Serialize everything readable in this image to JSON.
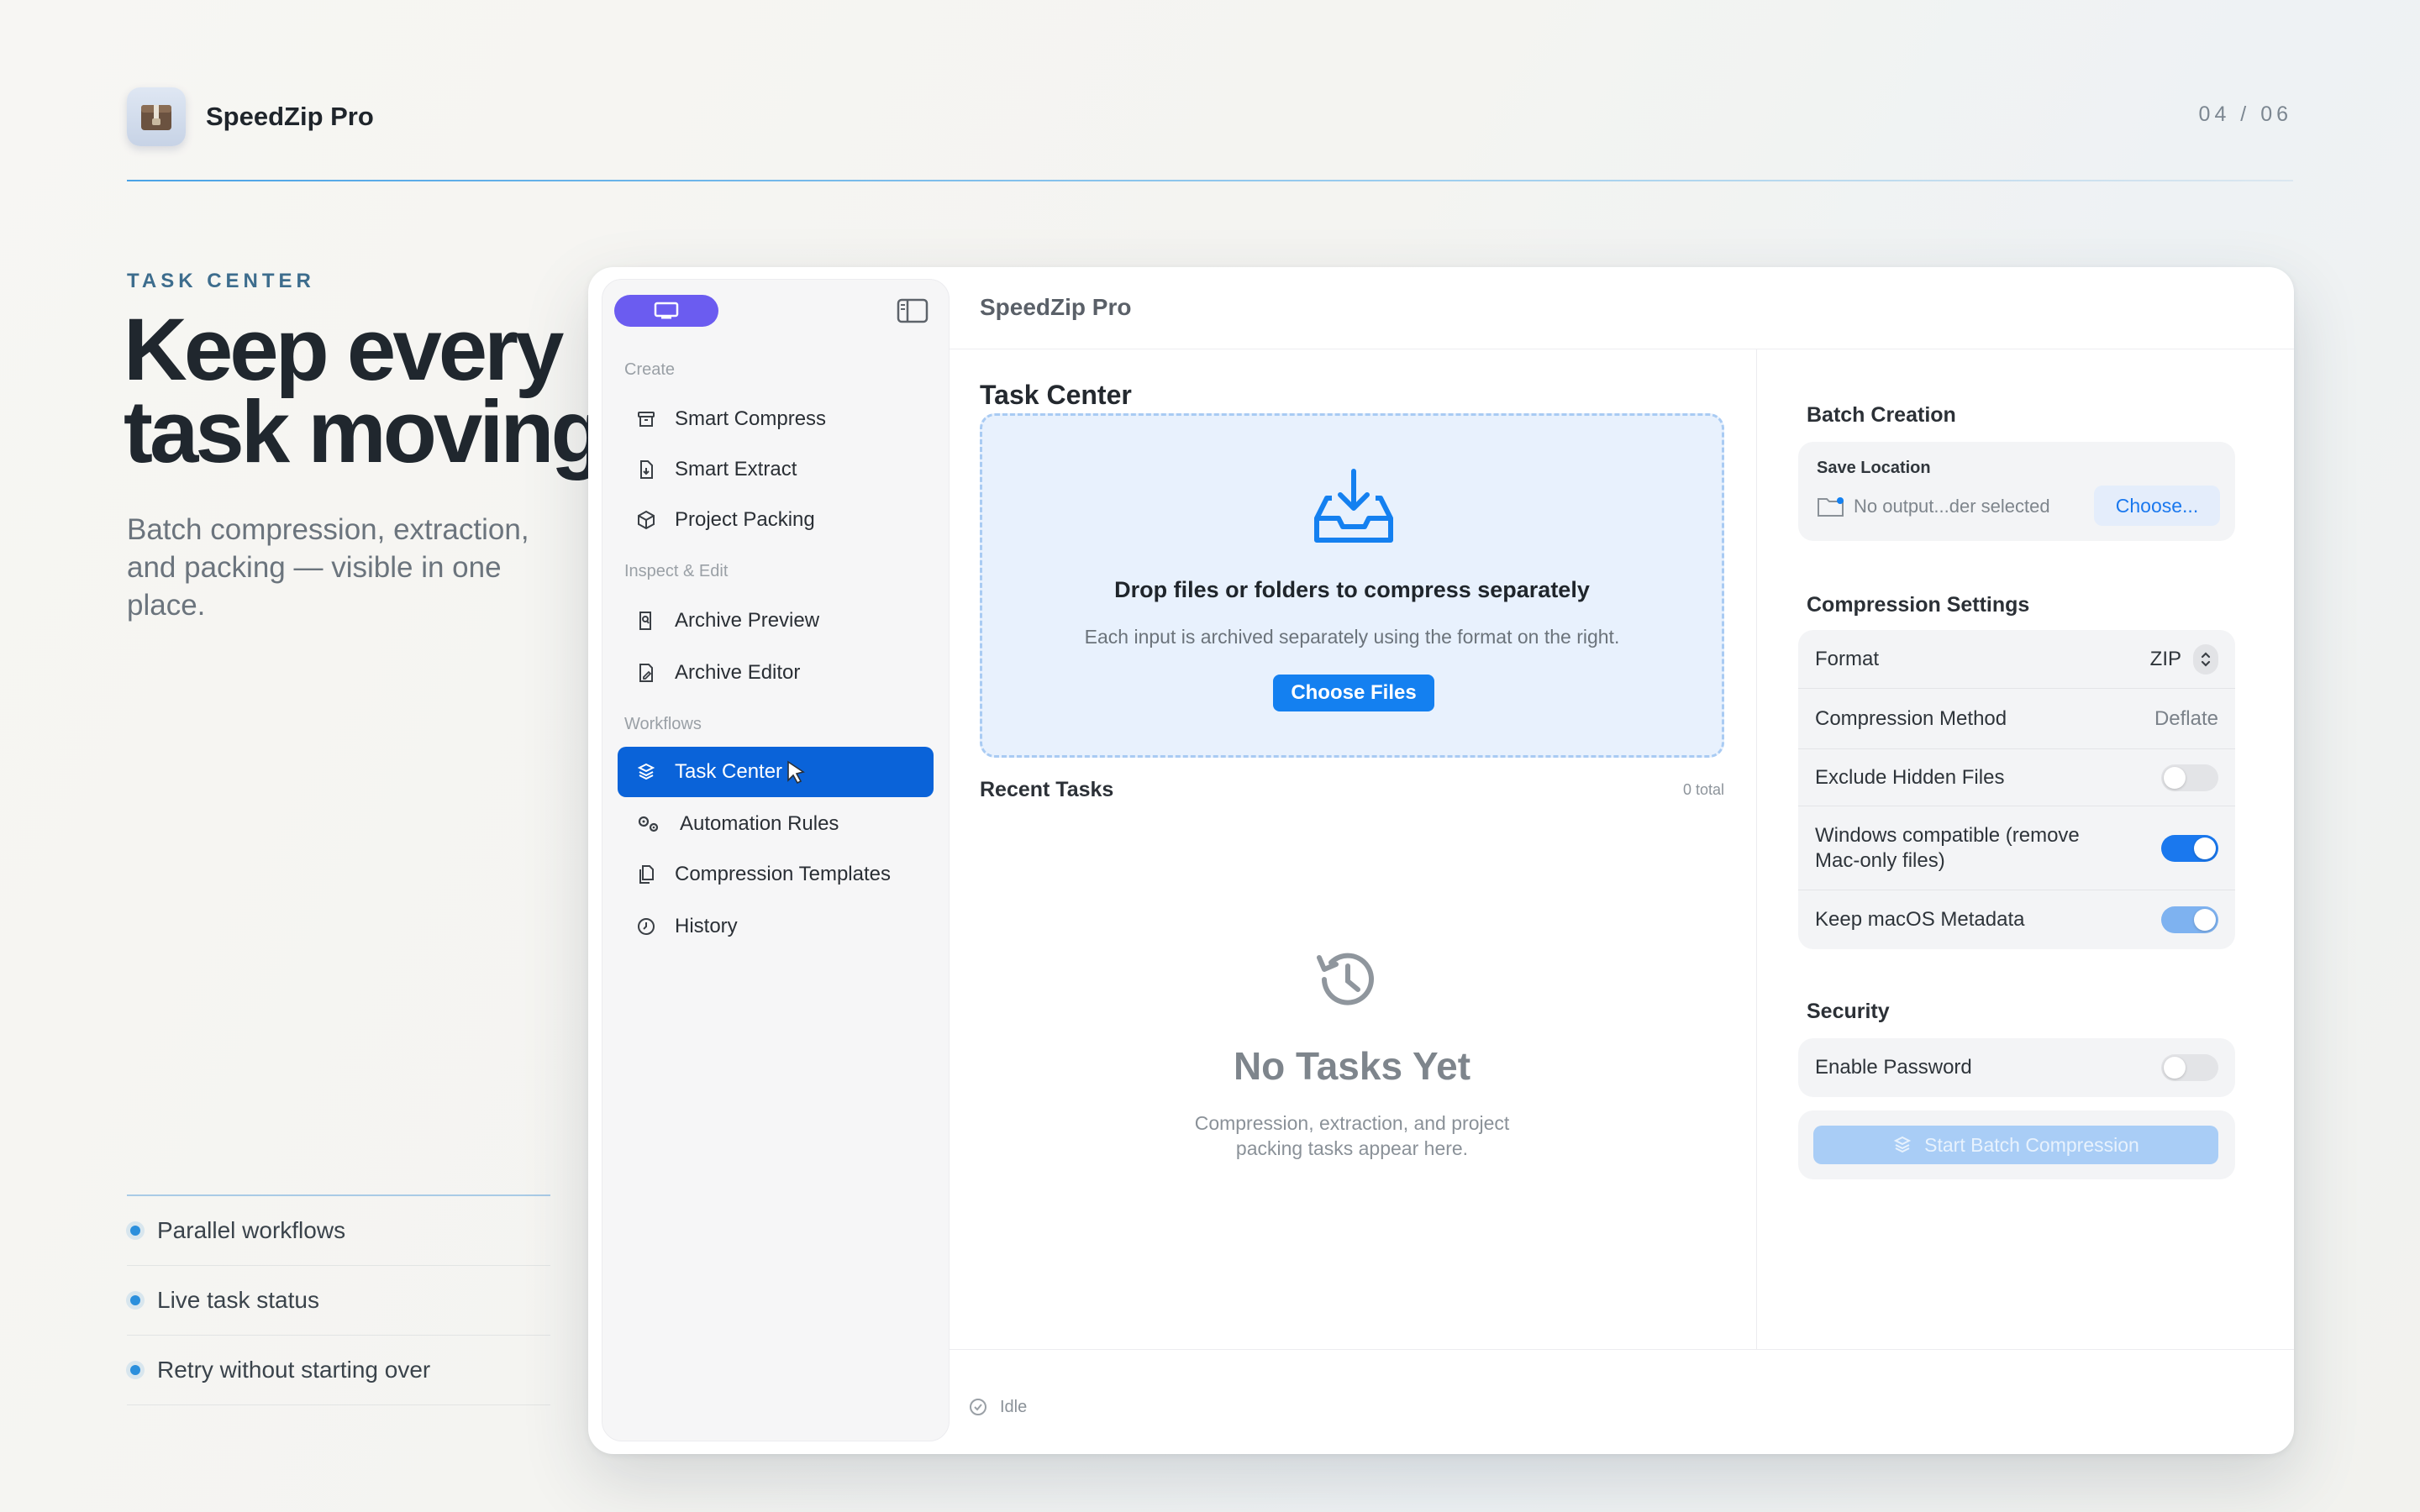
{
  "brand": {
    "name": "SpeedZip Pro",
    "page_counter": "04 / 06"
  },
  "hero": {
    "eyebrow": "TASK CENTER",
    "headline_line1": "Keep every",
    "headline_line2": "task moving.",
    "subcopy": "Batch compression, extraction, and packing — visible in one place."
  },
  "bullets": [
    "Parallel workflows",
    "Live task status",
    "Retry without starting over"
  ],
  "window": {
    "title": "SpeedZip Pro",
    "sidebar": {
      "sections": [
        {
          "label": "Create",
          "items": [
            "Smart Compress",
            "Smart Extract",
            "Project Packing"
          ]
        },
        {
          "label": "Inspect & Edit",
          "items": [
            "Archive Preview",
            "Archive Editor"
          ]
        },
        {
          "label": "Workflows",
          "items": [
            "Task Center",
            "Automation Rules",
            "Compression Templates",
            "History"
          ]
        }
      ],
      "active_item": "Task Center"
    },
    "main": {
      "title": "Task Center",
      "drop_title": "Drop files or folders to compress separately",
      "drop_subtitle": "Each input is archived separately using the format on the right.",
      "choose_files": "Choose Files",
      "recent_label": "Recent Tasks",
      "recent_count": "0 total",
      "empty_title": "No Tasks Yet",
      "empty_subtitle": "Compression, extraction, and project packing tasks appear here."
    },
    "panel": {
      "batch_heading": "Batch Creation",
      "save_location_label": "Save Location",
      "save_location_value": "No output...der selected",
      "choose_button": "Choose...",
      "compression_heading": "Compression Settings",
      "format_label": "Format",
      "format_value": "ZIP",
      "method_label": "Compression Method",
      "method_value": "Deflate",
      "exclude_hidden_label": "Exclude Hidden Files",
      "exclude_hidden_on": false,
      "windows_compat_label": "Windows compatible (remove Mac-only files)",
      "windows_compat_on": true,
      "keep_metadata_label": "Keep macOS Metadata",
      "keep_metadata_on": true,
      "security_heading": "Security",
      "password_label": "Enable Password",
      "password_on": false,
      "start_button": "Start Batch Compression"
    },
    "status": "Idle"
  },
  "colors": {
    "accent": "#1480f0",
    "active_sidebar": "#0a63d9",
    "sidebar_pill": "#6b5cf0",
    "rule": "#4aa3e6"
  }
}
